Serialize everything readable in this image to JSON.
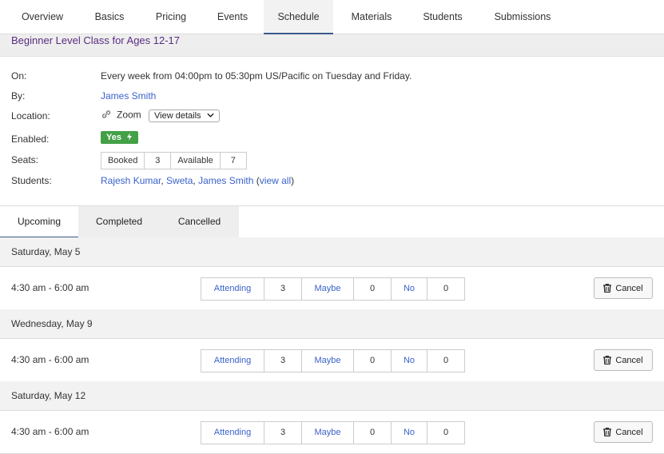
{
  "tabs": [
    {
      "label": "Overview"
    },
    {
      "label": "Basics"
    },
    {
      "label": "Pricing"
    },
    {
      "label": "Events"
    },
    {
      "label": "Schedule"
    },
    {
      "label": "Materials"
    },
    {
      "label": "Students"
    },
    {
      "label": "Submissions"
    }
  ],
  "active_tab": "Schedule",
  "title": "Beginner Level Class for Ages 12-17",
  "info": {
    "on_label": "On:",
    "on_value": "Every week from 04:00pm to 05:30pm US/Pacific on Tuesday and Friday.",
    "by_label": "By:",
    "by_value": "James Smith",
    "location_label": "Location:",
    "location_value": "Zoom",
    "view_details": "View details",
    "enabled_label": "Enabled:",
    "enabled_value": "Yes",
    "seats_label": "Seats:",
    "seats_booked_label": "Booked",
    "seats_booked": "3",
    "seats_available_label": "Available",
    "seats_available": "7",
    "students_label": "Students:",
    "students": [
      "Rajesh Kumar",
      "Sweta",
      "James Smith"
    ],
    "view_all": "view all"
  },
  "subtabs": [
    {
      "label": "Upcoming"
    },
    {
      "label": "Completed"
    },
    {
      "label": "Cancelled"
    }
  ],
  "sessions": [
    {
      "date": "Saturday, May 5",
      "time": "4:30 am - 6:00 am",
      "attending_label": "Attending",
      "attending": "3",
      "maybe_label": "Maybe",
      "maybe": "0",
      "no_label": "No",
      "no": "0",
      "cancel": "Cancel"
    },
    {
      "date": "Wednesday, May 9",
      "time": "4:30 am - 6:00 am",
      "attending_label": "Attending",
      "attending": "3",
      "maybe_label": "Maybe",
      "maybe": "0",
      "no_label": "No",
      "no": "0",
      "cancel": "Cancel"
    },
    {
      "date": "Saturday, May 12",
      "time": "4:30 am - 6:00 am",
      "attending_label": "Attending",
      "attending": "3",
      "maybe_label": "Maybe",
      "maybe": "0",
      "no_label": "No",
      "no": "0",
      "cancel": "Cancel"
    }
  ],
  "colors": {
    "accent": "#3a5a8c",
    "link": "#3a62c9",
    "title": "#5a2d82",
    "badge": "#43a047"
  }
}
